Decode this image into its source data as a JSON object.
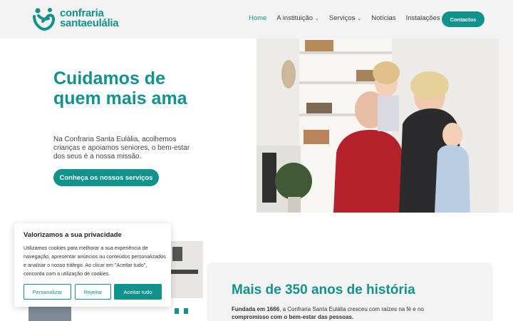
{
  "brand": {
    "line1": "confraria",
    "line2": "santaeulália",
    "accent": "#12928c"
  },
  "nav": {
    "items": [
      {
        "label": "Home",
        "active": true,
        "dropdown": false
      },
      {
        "label": "A instituição",
        "active": false,
        "dropdown": true
      },
      {
        "label": "Serviços",
        "active": false,
        "dropdown": true
      },
      {
        "label": "Notícias",
        "active": false,
        "dropdown": false
      },
      {
        "label": "Instalações",
        "active": false,
        "dropdown": false
      }
    ],
    "chevron": "chevron-down-icon",
    "contact_label": "Contactos"
  },
  "hero": {
    "title": "Cuidamos de quem mais ama",
    "text": "Na Confraria Santa Eulália, acolhemos crianças e apoiamos seniores, o bem-estar dos seus é a nossa missão.",
    "cta": "Conheça os nossos serviços"
  },
  "history": {
    "title": "Mais de 350 anos de história",
    "text_bold_1": "Fundada em 1666",
    "text_1": ", a Confraria Santa Eulália cresceu com raízes na fé e no",
    "text_bold_2": "compromisso com o bem-estar das pessoas."
  },
  "cookie": {
    "title": "Valorizamos a sua privacidade",
    "text": "Utilizamos cookies para melhorar a sua experiência de navegação, apresentar anúncios ou conteúdos personalizados e analisar o nosso tráfego. Ao clicar em \"Aceitar tudo\", concorda com a utilização de cookies.",
    "customize": "Personalizar",
    "reject": "Rejeitar",
    "accept": "Aceitar tudo"
  }
}
